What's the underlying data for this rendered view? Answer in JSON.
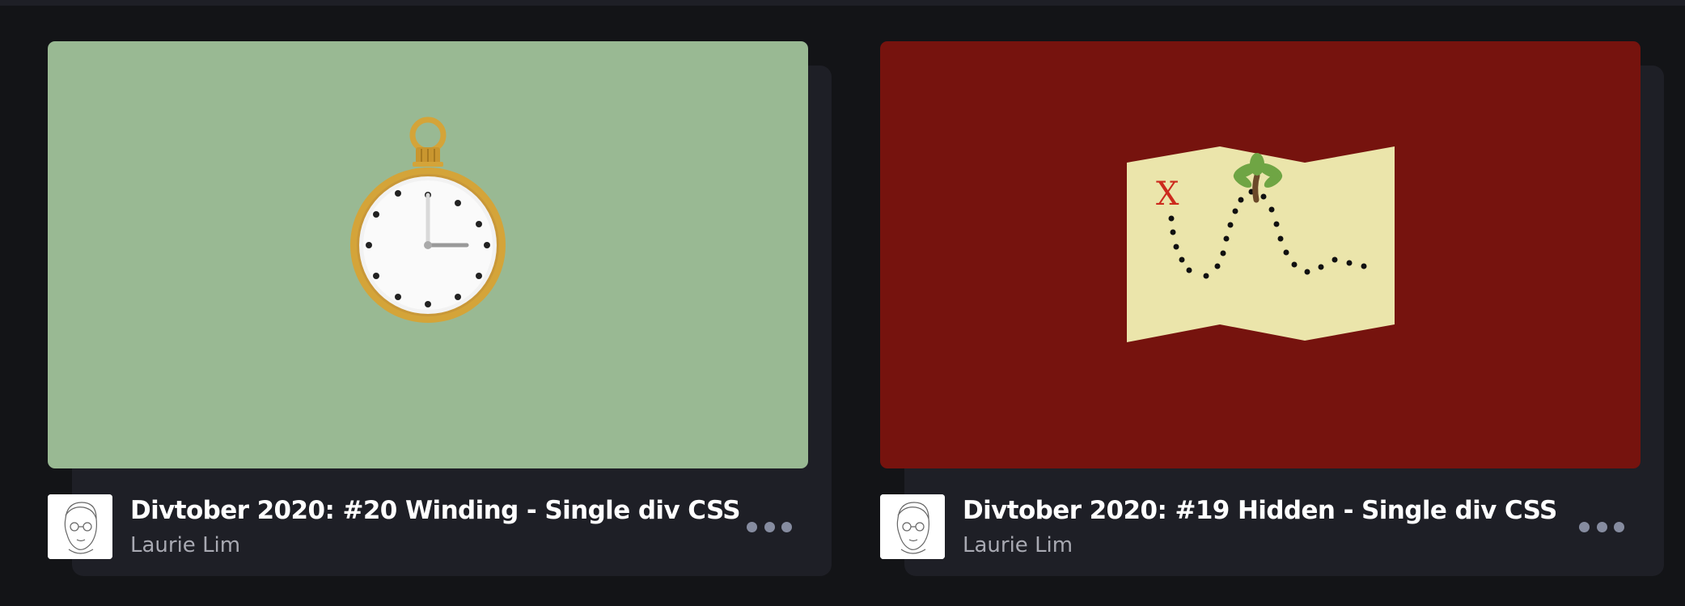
{
  "cards": [
    {
      "title": "Divtober 2020: #20 Winding - Single div CSS",
      "author": "Laurie Lim",
      "preview_bg": "#99b993",
      "preview_icon": "pocket-watch-icon",
      "more_icon": "more-dots-icon"
    },
    {
      "title": "Divtober 2020: #19 Hidden - Single div CSS",
      "author": "Laurie Lim",
      "preview_bg": "#76130e",
      "preview_icon": "treasure-map-icon",
      "map_mark": "X",
      "more_icon": "more-dots-icon"
    }
  ],
  "colors": {
    "page_bg": "#131417",
    "card_bg": "#1e1f26",
    "title_text": "#ffffff",
    "author_text": "#a8a9b2"
  }
}
